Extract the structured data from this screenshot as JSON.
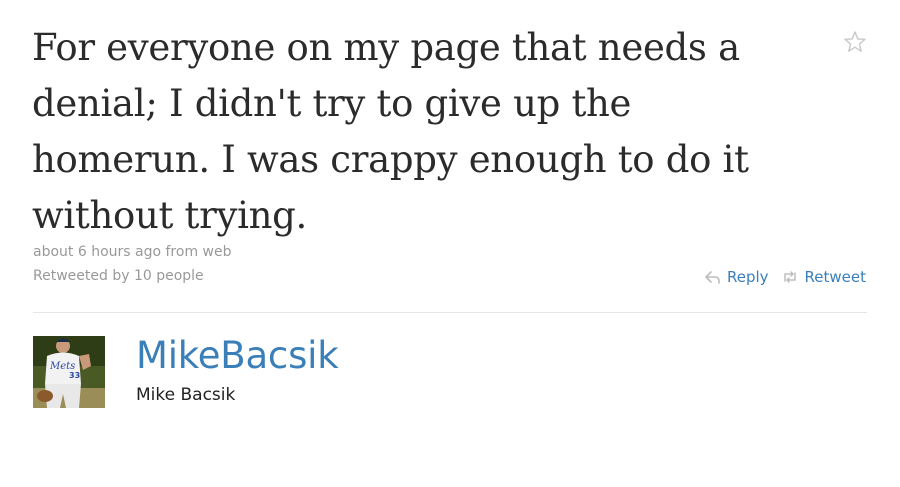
{
  "tweet": {
    "text": "For everyone on my page that needs a denial; I didn't try to give up the homerun. I was crappy enough to do it without trying.",
    "time": "about 6 hours ago",
    "from_word": "from",
    "source": "web",
    "retweet_prefix": "Retweeted by",
    "retweet_count": "10 people"
  },
  "actions": {
    "reply_label": "Reply",
    "retweet_label": "Retweet"
  },
  "user": {
    "screen_name": "MikeBacsik",
    "full_name": "Mike Bacsik",
    "avatar_icon": "user-photo-avatar"
  },
  "icons": {
    "favorite": "star-icon",
    "reply": "reply-arrow-icon",
    "retweet": "retweet-arrows-icon"
  },
  "colors": {
    "link": "#3b7fb8",
    "meta": "#999999",
    "text": "#2b2b2b",
    "star": "#c8c8c8"
  }
}
